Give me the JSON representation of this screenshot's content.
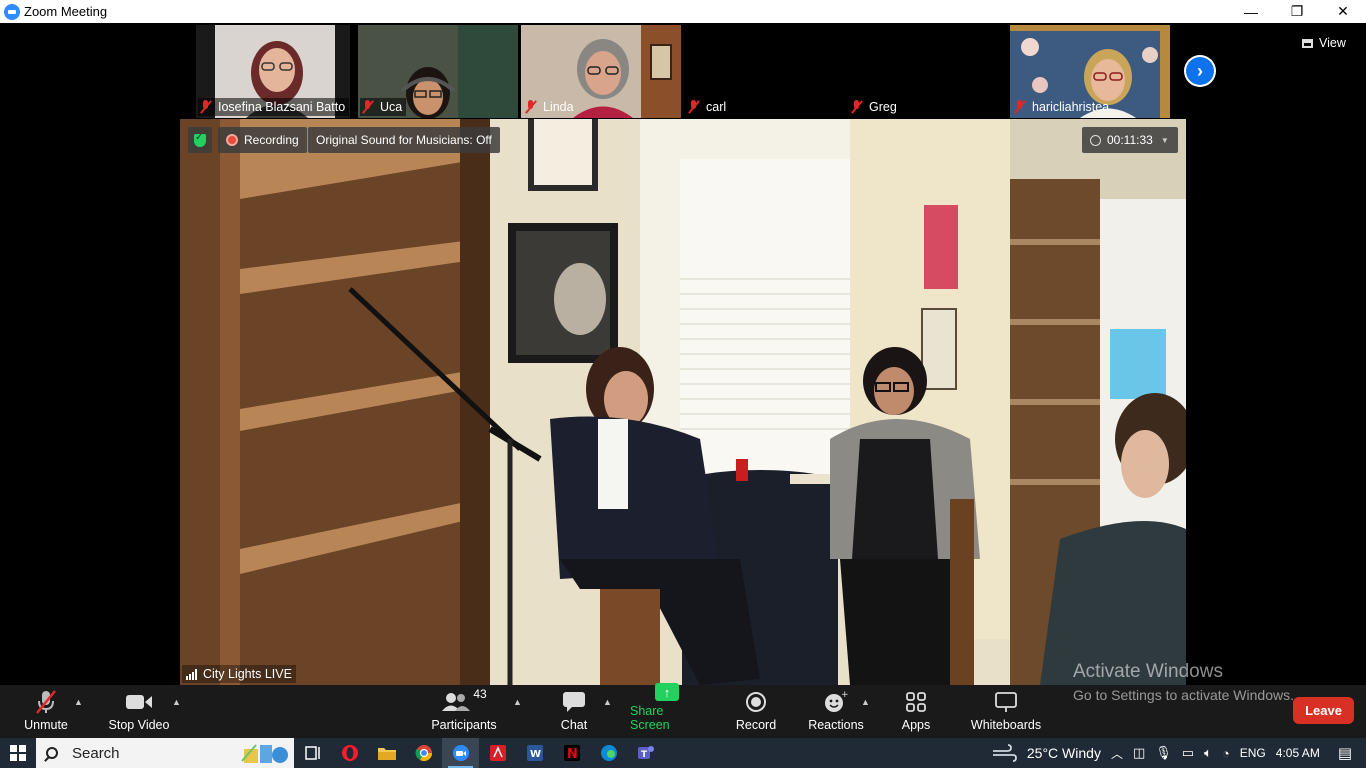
{
  "window": {
    "title": "Zoom Meeting",
    "controls": {
      "minimize": "—",
      "restore": "❐",
      "close": "✕"
    }
  },
  "thumbnails": [
    {
      "name": "Iosefina Blazsani Batto",
      "muted": true,
      "bg": "#d9d4cf",
      "skin": "#e5b59b",
      "hair": "#6b2a2a"
    },
    {
      "name": "Uca",
      "muted": true,
      "bg": "#4a5245",
      "skin": "#c9926c",
      "hair": "#1c1410"
    },
    {
      "name": "Linda",
      "muted": true,
      "bg": "#c8b9a8",
      "skin": "#d8a48c",
      "hair": "#8a8782"
    },
    {
      "name": "carl",
      "muted": true,
      "bg": null
    },
    {
      "name": "Greg",
      "muted": true,
      "bg": null
    },
    {
      "name": "haricliahristea",
      "muted": true,
      "bg": "#3d5a80",
      "skin": "#e7b89a",
      "hair": "#c9a55a"
    }
  ],
  "view_label": "View",
  "overlay": {
    "recording_label": "Recording",
    "sound_label": "Original Sound for Musicians: Off",
    "timer": "00:11:33"
  },
  "speaker_label": "City Lights LIVE",
  "toolbar": {
    "unmute": "Unmute",
    "stop_video": "Stop Video",
    "participants": "Participants",
    "participants_count": "43",
    "chat": "Chat",
    "share_screen": "Share Screen",
    "record": "Record",
    "reactions": "Reactions",
    "apps": "Apps",
    "whiteboards": "Whiteboards",
    "leave": "Leave"
  },
  "watermark": {
    "line1": "Activate Windows",
    "line2": "Go to Settings to activate Windows."
  },
  "taskbar": {
    "search": "Search",
    "weather": "25°C  Windy",
    "language": "ENG",
    "time": "4:05 AM"
  },
  "colors": {
    "zoom_blue": "#2D8CFF",
    "share_green": "#23d160",
    "leave_red": "#d93025",
    "mute_red": "#e02828"
  }
}
